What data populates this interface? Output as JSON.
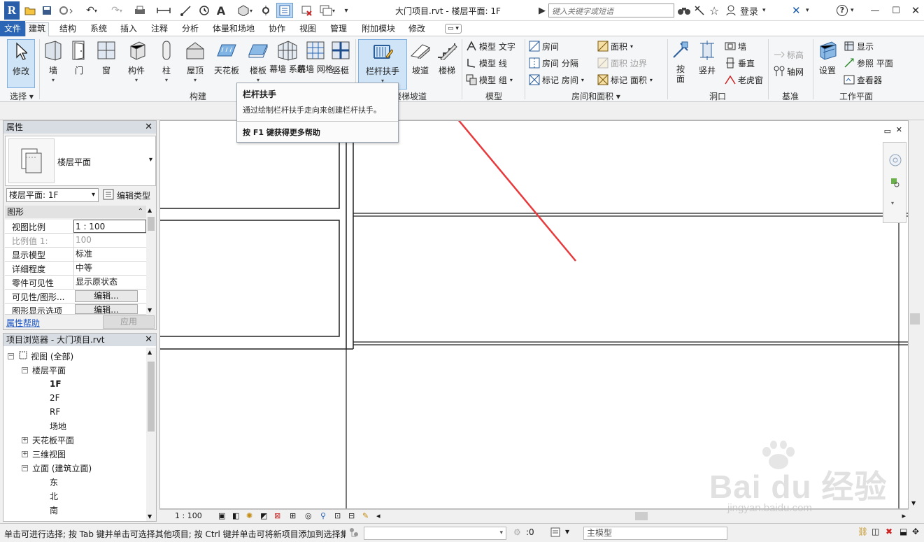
{
  "title_bar": {
    "logo": "R",
    "title": "大门项目.rvt - 楼层平面: 1F",
    "search_placeholder": "键入关键字或短语",
    "login": "登录",
    "help": "?"
  },
  "menu": {
    "tabs": [
      "文件",
      "建筑",
      "结构",
      "系统",
      "插入",
      "注释",
      "分析",
      "体量和场地",
      "协作",
      "视图",
      "管理",
      "附加模块",
      "修改"
    ],
    "active": "建筑"
  },
  "ribbon": {
    "select": {
      "modify": "修改",
      "panel": "选择"
    },
    "build": {
      "panel": "构建",
      "buttons": [
        "墙",
        "门",
        "窗",
        "构件",
        "柱",
        "屋顶",
        "天花板",
        "楼板",
        "幕墙\n系统",
        "幕墙\n网格",
        "竖梃"
      ]
    },
    "circulation": {
      "panel": "楼梯坡道",
      "buttons": [
        "栏杆扶手",
        "坡道",
        "楼梯"
      ]
    },
    "model": {
      "panel": "模型",
      "items": [
        "模型 文字",
        "模型 线",
        "模型 组"
      ]
    },
    "room": {
      "panel": "房间和面积",
      "items": [
        "房间",
        "房间 分隔",
        "标记 房间",
        "面积",
        "面积 边界",
        "标记 面积"
      ]
    },
    "opening": {
      "panel": "洞口",
      "big": [
        "按\n面",
        "竖井"
      ],
      "items": [
        "墙",
        "垂直",
        "老虎窗"
      ]
    },
    "datum": {
      "panel": "基准",
      "items": [
        "标高",
        "轴网"
      ]
    },
    "workplane": {
      "panel": "工作平面",
      "big": "设置",
      "items": [
        "显示",
        "参照 平面",
        "查看器"
      ]
    }
  },
  "tooltip": {
    "title": "栏杆扶手",
    "description": "通过绘制栏杆扶手走向来创建栏杆扶手。",
    "help": "按 F1 键获得更多帮助"
  },
  "properties": {
    "header": "属性",
    "type_name": "楼层平面",
    "instance": "楼层平面: 1F",
    "edit_type": "编辑类型",
    "category": "图形",
    "rows": [
      {
        "key": "视图比例",
        "value": "1 : 100"
      },
      {
        "key": "比例值 1:",
        "value": "100"
      },
      {
        "key": "显示模型",
        "value": "标准"
      },
      {
        "key": "详细程度",
        "value": "中等"
      },
      {
        "key": "零件可见性",
        "value": "显示原状态"
      },
      {
        "key": "可见性/图形...",
        "value": "编辑..."
      },
      {
        "key": "图形显示选项",
        "value": "编辑..."
      }
    ],
    "help_link": "属性帮助",
    "apply": "应用"
  },
  "browser": {
    "header": "项目浏览器 - 大门项目.rvt",
    "nodes": [
      "视图 (全部)",
      "楼层平面",
      "1F",
      "2F",
      "RF",
      "场地",
      "天花板平面",
      "三维视图",
      "立面 (建筑立面)",
      "东",
      "北",
      "南"
    ]
  },
  "view_control": {
    "scale": "1 : 100"
  },
  "status_bar": {
    "message": "单击可进行选择; 按 Tab 键并单击可选择其他项目; 按 Ctrl 键并单击可将新项目添加到选择集",
    "selection_count": ":0",
    "model": "主模型"
  },
  "watermark": {
    "main": "Bai du 经验",
    "url": "jingyan.baidu.com"
  },
  "colors": {
    "accent": "#2a66b5",
    "arrow": "#e8393c",
    "highlight": "#cfe4f7"
  }
}
